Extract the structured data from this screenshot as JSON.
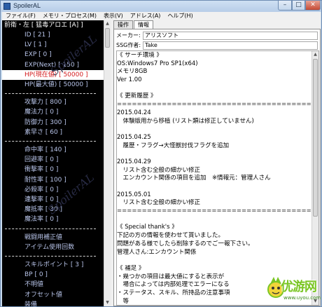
{
  "window": {
    "title": "SpoilerAL",
    "minimize_glyph": "–",
    "maximize_glyph": "□",
    "close_glyph": "✕"
  },
  "menu": [
    "ファイル(F)",
    "メモリ・プロセス(M)",
    "表示(V)",
    "アドレス(A)",
    "ヘルプ(H)"
  ],
  "left": {
    "header": "前衛・左 [ 猛毒アロエ [A] ]",
    "watermark": "SpoilerAL",
    "rows": [
      {
        "label": "ID [ 21 ]",
        "indent": 1
      },
      {
        "label": "LV [ 1 ]",
        "indent": 1
      },
      {
        "label": "EXP [ 0 ]",
        "indent": 1
      },
      {
        "label": "EXP(Next) [ 150 ]",
        "indent": 1
      },
      {
        "label": "HP(現在値) [ 50000 ]",
        "indent": 1,
        "selected": true
      },
      {
        "label": "HP(最大値) [ 50000 ]",
        "indent": 1
      },
      {
        "label": "攻撃力 [ 800 ]",
        "indent": 1
      },
      {
        "label": "魔法力 [ 0 ]",
        "indent": 1
      },
      {
        "label": "防御力 [ 300 ]",
        "indent": 1
      },
      {
        "label": "素早さ [ 60 ]",
        "indent": 1
      },
      {
        "label": "命中率 [ 140 ]",
        "indent": 1
      },
      {
        "label": "回避率 [ 0 ]",
        "indent": 1
      },
      {
        "label": "衝撃率 [ 0 ]",
        "indent": 1
      },
      {
        "label": "耐性率 [ 100 ]",
        "indent": 1
      },
      {
        "label": "必殺率 [ 0 ]",
        "indent": 1
      },
      {
        "label": "連撃率 [ 0 ]",
        "indent": 1
      },
      {
        "label": "魔抵率 [ 30 ]",
        "indent": 1
      },
      {
        "label": "魔法率 [ 0 ]",
        "indent": 1
      },
      {
        "label": "戦闘用補正値",
        "indent": 1
      },
      {
        "label": "アイテム使用回数",
        "indent": 1
      },
      {
        "label": "スキルポイント [ 3 ]",
        "indent": 1
      },
      {
        "label": "BP [ 0 ]",
        "indent": 1
      },
      {
        "label": "不明値",
        "indent": 1
      },
      {
        "label": "オフセット値",
        "indent": 1
      },
      {
        "label": "装備",
        "indent": 1
      }
    ]
  },
  "right": {
    "tabs": [
      "操作",
      "情報"
    ],
    "active_tab": 1,
    "maker_label": "メーカー:",
    "maker_value": "アリスソフト",
    "ssg_label": "SSG作者:",
    "ssg_value": "Take",
    "lines": [
      "《 サーチ環境 》",
      "OS:Windows7 Pro SP1(x64)",
      "メモリ8GB",
      "Ver 1.00",
      "",
      "《 更新履歴 》",
      "==========================================",
      "2015.04.24",
      "　体験版用から移植 (リスト類は修正していません)",
      "",
      "2015.04.25",
      "　履歴・フラグ→大怪獣討伐フラグを追加",
      "",
      "2015.04.29",
      "　リスト含む全般の細かい修正",
      "　エンカウント関係の項目を追加　※情報元：管理人さん",
      "",
      "2015.05.01",
      "　リスト含む全般の細かい修正",
      "==========================================",
      "",
      "《 Special thank's 》",
      "下記の方の情報を使わせて貰いました。",
      "問題がある様でしたら削除するのでご一報下さい。",
      "管理人さん:エンカウント関係",
      "",
      "《 補足 》",
      "・幾つかの項目は最大値にすると表示が",
      "　場合によっては内部処理でエラーになる",
      "・ステータス、スキル、所持品の注意事項",
      "　等"
    ]
  },
  "logo": {
    "text": "优游网",
    "sub": "www.uyou.com"
  }
}
